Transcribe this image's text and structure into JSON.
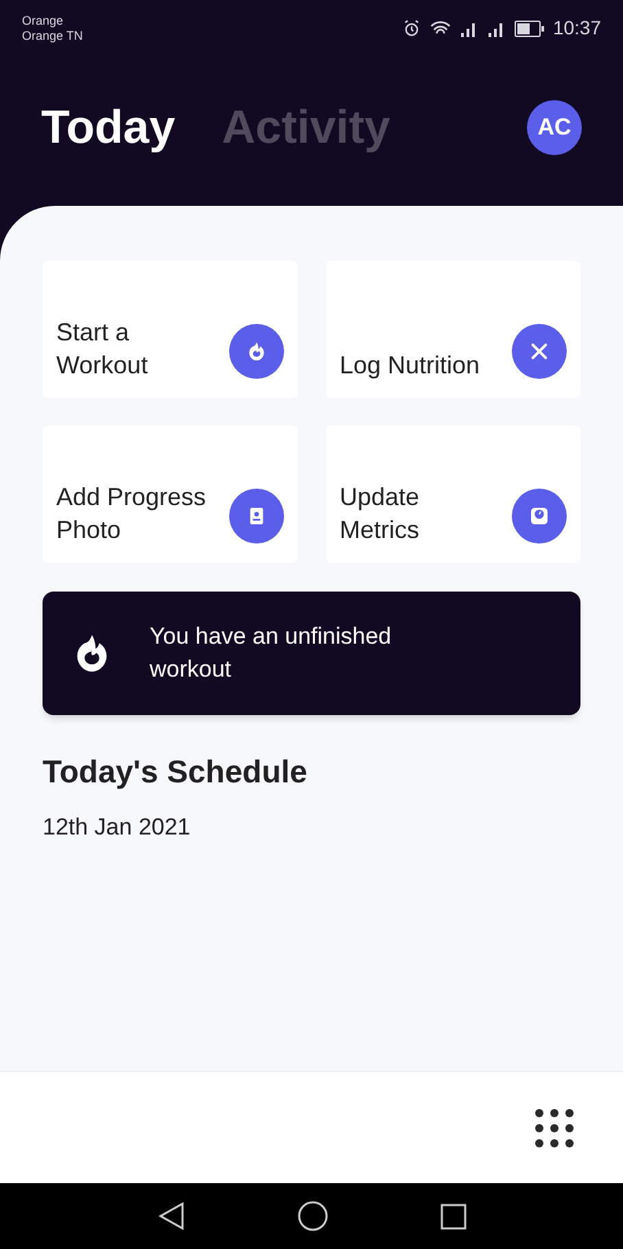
{
  "status_bar": {
    "carrier": "Orange",
    "network": "Orange TN",
    "time": "10:37"
  },
  "tabs": [
    {
      "label": "Today",
      "selected": true
    },
    {
      "label": "Activity",
      "selected": false
    }
  ],
  "avatar": {
    "initials": "AC"
  },
  "actions": [
    {
      "label": "Start a Workout",
      "kind": "flame"
    },
    {
      "label": "Log Nutrition",
      "kind": "utensils"
    },
    {
      "label": "Add Progress Photo",
      "kind": "photo"
    },
    {
      "label": "Update Metrics",
      "kind": "scale"
    }
  ],
  "banner": {
    "text": "You have an unfinished workout"
  },
  "schedule": {
    "title": "Today's Schedule",
    "date": "12th Jan 2021"
  }
}
